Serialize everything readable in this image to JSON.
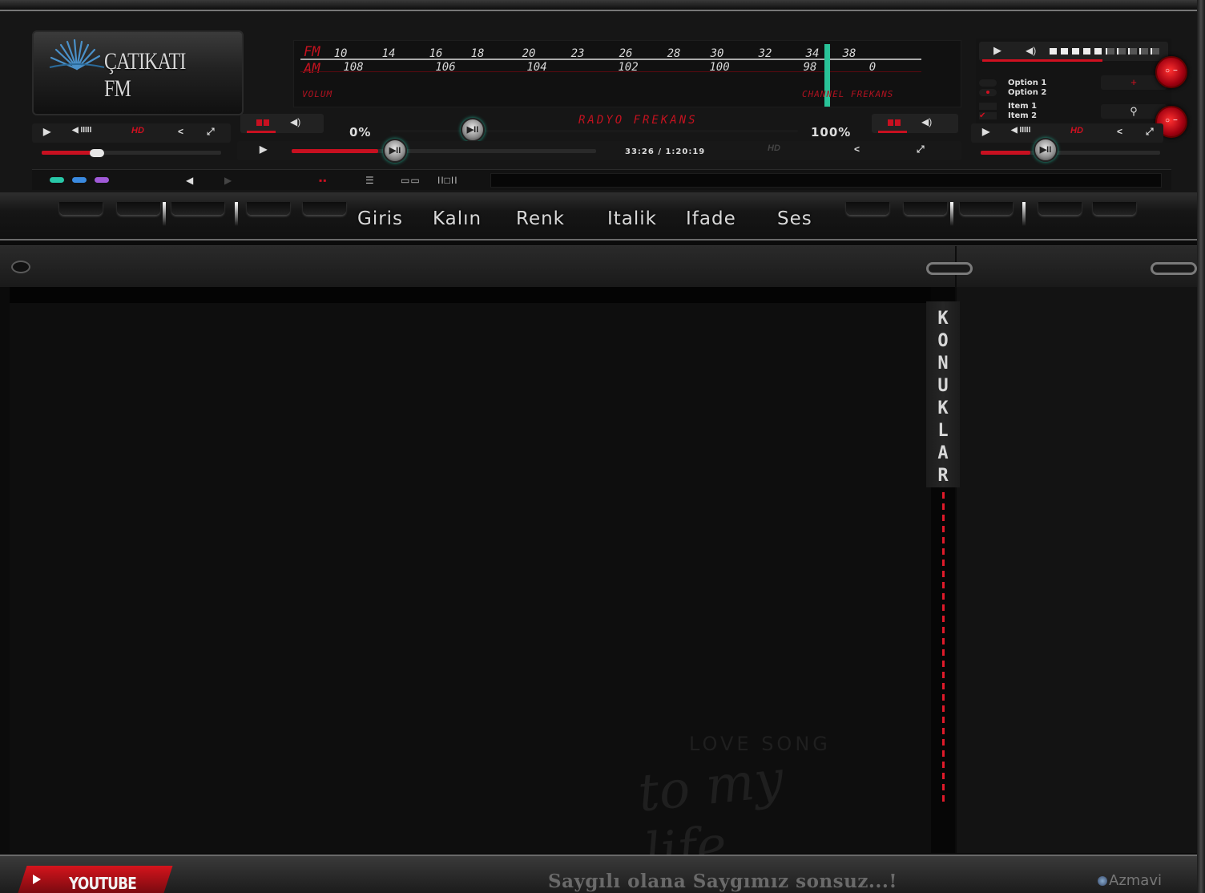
{
  "logo": {
    "text": "ÇATIKATI FM"
  },
  "tuner": {
    "fm_label": "FM",
    "am_label": "AM",
    "fm_scale": [
      "10",
      "14",
      "16",
      "18",
      "20",
      "23",
      "26",
      "28",
      "30",
      "32",
      "34",
      "38"
    ],
    "am_scale": [
      "108",
      "106",
      "104",
      "102",
      "100",
      "98",
      "0"
    ],
    "left_label": "VOLUM",
    "right_label": "CHANNEL FREKANS"
  },
  "options": {
    "option1": "Option 1",
    "option2": "Option 2",
    "item1": "Item 1",
    "item2": "Item 2"
  },
  "controls": {
    "hd": "HD",
    "volume_min": "0%",
    "volume_max": "100%",
    "radio_label": "RADYO FREKANS",
    "time": "33:26 / 1:20:19"
  },
  "menu": [
    "Giris",
    "Kalın",
    "Renk",
    "Italik",
    "Ifade",
    "Ses"
  ],
  "sidebar": {
    "letters": [
      "K",
      "O",
      "N",
      "U",
      "K",
      "L",
      "A",
      "R"
    ]
  },
  "watermark": {
    "small": "LOVE SONG",
    "script": "to my life"
  },
  "footer": {
    "youtube": "YOUTUBE",
    "motto": "Saygılı olana  Saygımız sonsuz...!",
    "credit": "Azmavi"
  },
  "colors": {
    "accent_red": "#c81020",
    "needle_green": "#29c398",
    "bg": "#0e0e0e"
  }
}
